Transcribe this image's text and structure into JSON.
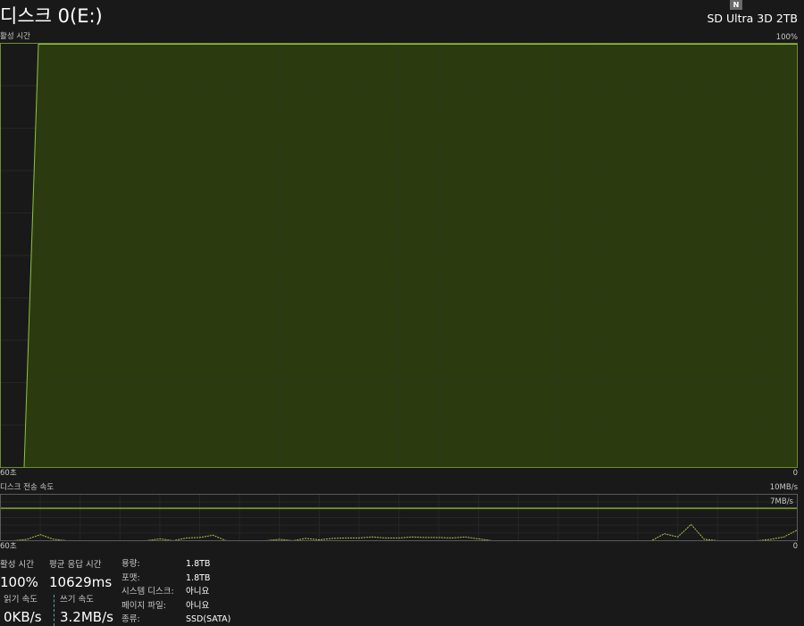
{
  "header": {
    "title": "디스크 0(E:)",
    "model": "SD Ultra 3D 2TB",
    "badge": "N"
  },
  "activity_graph": {
    "label": "활성 시간",
    "max_label": "100%",
    "time_left": "60초",
    "time_right": "0",
    "fill_color": "#2c3a10",
    "line_color": "#8fc43c",
    "grid_color": "#2a3b18",
    "chart_data": {
      "type": "area",
      "ylim": [
        0,
        100
      ],
      "x_range_seconds": [
        60,
        0
      ],
      "values": [
        0,
        100,
        100,
        100,
        100,
        100,
        100,
        100,
        100,
        100,
        100,
        100,
        100,
        100,
        100,
        100,
        100,
        100,
        100,
        100,
        100,
        100,
        100,
        100,
        100,
        100,
        100,
        100,
        100,
        100,
        100,
        100,
        100,
        100,
        100,
        100,
        100,
        100,
        100,
        100,
        100,
        100,
        100,
        100,
        100,
        100,
        100,
        100,
        100,
        100,
        100,
        100,
        100,
        100,
        100,
        100,
        100,
        100,
        100,
        100,
        100
      ]
    }
  },
  "transfer_graph": {
    "label": "디스크 전송 속도",
    "max_label": "10MB/s",
    "line_label": "7MB/s",
    "time_left": "60초",
    "time_right": "0",
    "chart_data": {
      "type": "line",
      "ylim": [
        0,
        10
      ],
      "reference_line": 7,
      "x_range_seconds": [
        60,
        0
      ],
      "series": [
        {
          "values": [
            0,
            0,
            0.3,
            1.3,
            0.3,
            0,
            0,
            0,
            0,
            0,
            0,
            0,
            0.4,
            0,
            0.6,
            0.7,
            1.2,
            0,
            0,
            0,
            0,
            0.3,
            0,
            0.5,
            0.2,
            0.5,
            0.6,
            0.6,
            0.8,
            0.6,
            0.6,
            0.8,
            0.7,
            0.7,
            0.6,
            0.8,
            0.4,
            0,
            0,
            0,
            0,
            0,
            0,
            0,
            0,
            0,
            0,
            0,
            0,
            0,
            1.5,
            0.8,
            3.5,
            0.3,
            0,
            0,
            0,
            0,
            0.3,
            0.8,
            2.3
          ]
        }
      ]
    }
  },
  "stats": {
    "active_time_label": "활성 시간",
    "active_time_value": "100%",
    "response_label": "평균 응답 시간",
    "response_value": "10629ms",
    "read_label": "읽기 속도",
    "read_value": "0KB/s",
    "write_label": "쓰기 속도",
    "write_value": "3.2MB/s"
  },
  "info": [
    {
      "key": "용량:",
      "value": "1.8TB"
    },
    {
      "key": "포맷:",
      "value": "1.8TB"
    },
    {
      "key": "시스템 디스크:",
      "value": "아니요"
    },
    {
      "key": "페이지 파일:",
      "value": "아니요"
    },
    {
      "key": "종류:",
      "value": "SSD(SATA)"
    }
  ]
}
